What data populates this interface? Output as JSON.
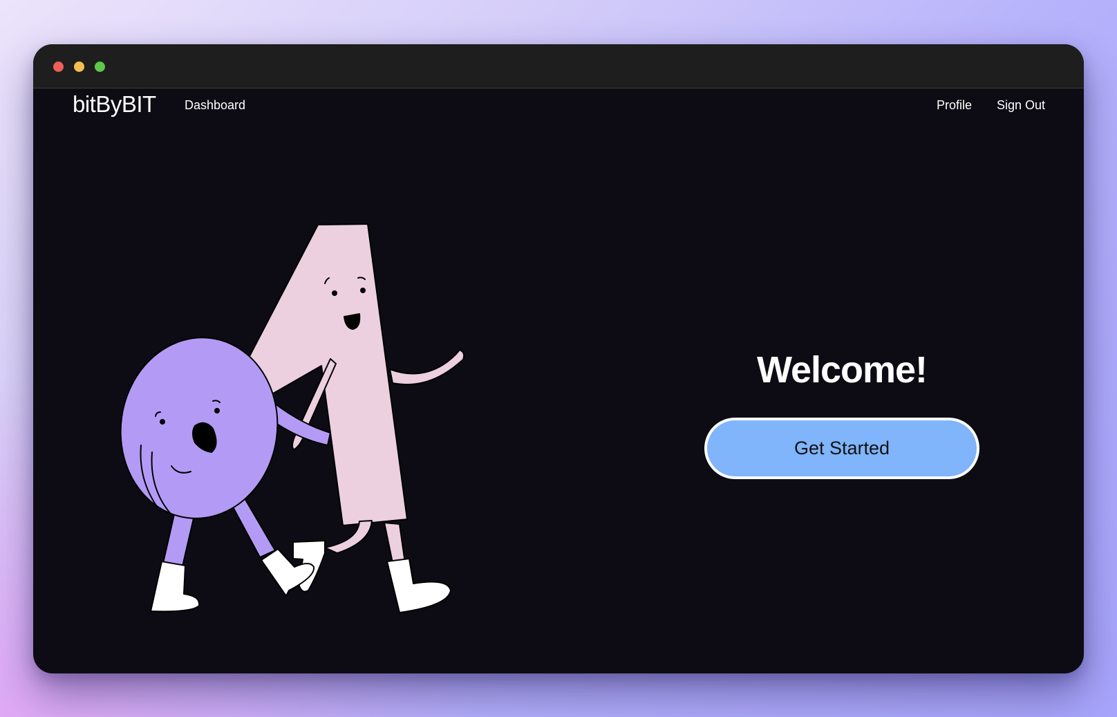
{
  "app": {
    "brand": "bitByBIT"
  },
  "nav": {
    "dashboard": "Dashboard",
    "profile": "Profile",
    "signout": "Sign Out"
  },
  "hero": {
    "title": "Welcome!",
    "cta_label": "Get Started"
  },
  "colors": {
    "window_bg": "#0d0c14",
    "titlebar_bg": "#1e1e1e",
    "cta_bg": "#80b4fb",
    "zero_character": "#b39bf5",
    "one_character": "#ecd0e0"
  },
  "icons": {
    "close": "traffic-light-red",
    "minimize": "traffic-light-yellow",
    "maximize": "traffic-light-green"
  }
}
